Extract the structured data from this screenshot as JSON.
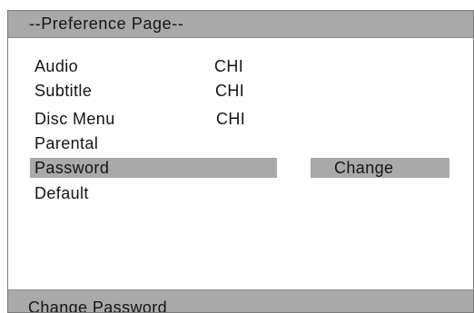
{
  "page": {
    "title": "--Preference Page--"
  },
  "menu": {
    "items": [
      {
        "label": "Audio",
        "value": "CHI"
      },
      {
        "label": "Subtitle",
        "value": "CHI"
      },
      {
        "label": "Disc Menu",
        "value": "CHI"
      },
      {
        "label": "Parental",
        "value": ""
      },
      {
        "label": "Password",
        "value": ""
      },
      {
        "label": "Default",
        "value": ""
      }
    ],
    "selected": "Password"
  },
  "password_submenu": {
    "option_label": "Change"
  },
  "status": {
    "text": "Change Password"
  },
  "colors": {
    "highlight": "#a9a9a9",
    "background": "#ffffff",
    "text": "#141414"
  }
}
